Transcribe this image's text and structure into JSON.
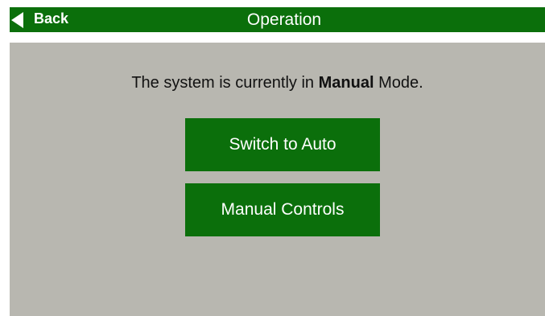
{
  "header": {
    "back_label": "Back",
    "title": "Operation",
    "icons": {
      "back": "back-arrow-icon"
    }
  },
  "status": {
    "prefix": "The system is currently in ",
    "mode": "Manual",
    "suffix": " Mode."
  },
  "buttons": {
    "switch_to_auto": "Switch to Auto",
    "manual_controls": "Manual Controls"
  },
  "colors": {
    "accent_green": "#0b6f0b",
    "panel_gray": "#b8b7b0",
    "text_dark": "#111111",
    "text_light": "#ffffff"
  }
}
